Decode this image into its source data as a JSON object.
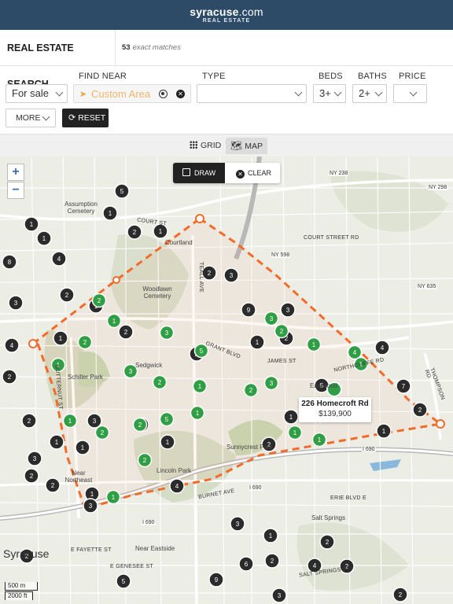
{
  "header": {
    "brand_main": "syracuse",
    "brand_tld": ".com",
    "brand_sub": "REAL ESTATE"
  },
  "search": {
    "title": "REAL ESTATE SEARCH",
    "match_count": "53",
    "match_text": "exact matches"
  },
  "filters": {
    "listing_type": "For sale",
    "find_near_label": "FIND NEAR",
    "find_near_placeholder": "Custom Area",
    "type_label": "TYPE",
    "type_value": "",
    "beds_label": "BEDS",
    "beds_value": "3+",
    "baths_label": "BATHS",
    "baths_value": "2+",
    "price_label": "PRICE",
    "price_value": "",
    "more_label": "MORE",
    "reset_label": "RESET"
  },
  "view": {
    "grid_label": "GRID",
    "map_label": "MAP",
    "active": "map"
  },
  "map": {
    "zoom_in": "+",
    "zoom_out": "−",
    "draw_label": "DRAW",
    "clear_label": "CLEAR",
    "popup": {
      "address": "226 Homecroft Rd",
      "price": "$139,900"
    },
    "scale_metric": "500 m",
    "scale_imperial": "2000 ft",
    "city_label": "Syracuse",
    "place_labels": [
      "Assumption Cemetery",
      "Woodlawn Cemetery",
      "Sedgwick",
      "Schiller Park",
      "Sunnycrest Park",
      "Lincoln Park",
      "Near Northeast",
      "Eastwood",
      "Salt Springs",
      "Near Eastside",
      "Courtland"
    ],
    "road_labels": [
      "TEALL AVE",
      "GRANT BLVD",
      "JAMES ST",
      "NORTHCLIFFE RD",
      "BURNET AVE",
      "ERIE BLVD E",
      "E FAYETTE ST",
      "E GENESEE ST",
      "THOMPSON RD",
      "BUTTERNUT ST",
      "COURT ST",
      "SALT SPRINGS RD",
      "COURT STREET RD"
    ],
    "highway_labels": [
      "NY 238",
      "NY 298",
      "NY 598",
      "NY 635",
      "I 690",
      "I 690",
      "I 690"
    ],
    "colors": {
      "cluster_dark": "#2b2b2b",
      "cluster_green": "#2f9e44",
      "draw_line": "#f26b2a"
    },
    "dark_markers": [
      "5",
      "1",
      "1",
      "2",
      "1",
      "1",
      "4",
      "8",
      "3",
      "4",
      "2",
      "2",
      "2",
      "1",
      "3",
      "9",
      "3",
      "2",
      "1",
      "1",
      "2",
      "4",
      "2",
      "5",
      "7",
      "2",
      "3",
      "1",
      "1",
      "1",
      "1",
      "3",
      "2",
      "2",
      "2",
      "1",
      "1",
      "2",
      "2",
      "3",
      "1",
      "1",
      "3",
      "4",
      "2",
      "6",
      "2",
      "4",
      "2",
      "9",
      "5",
      "2",
      "3",
      "2"
    ],
    "green_markers": [
      "2",
      "1",
      "3",
      "2",
      "1",
      "3",
      "2",
      "1",
      "5",
      "4",
      "3",
      "2",
      "1",
      "2",
      "3",
      "1",
      "2",
      "1",
      "2",
      "5",
      "2",
      "1",
      "1",
      "1",
      "2",
      "1"
    ],
    "paired_marker": "2"
  }
}
